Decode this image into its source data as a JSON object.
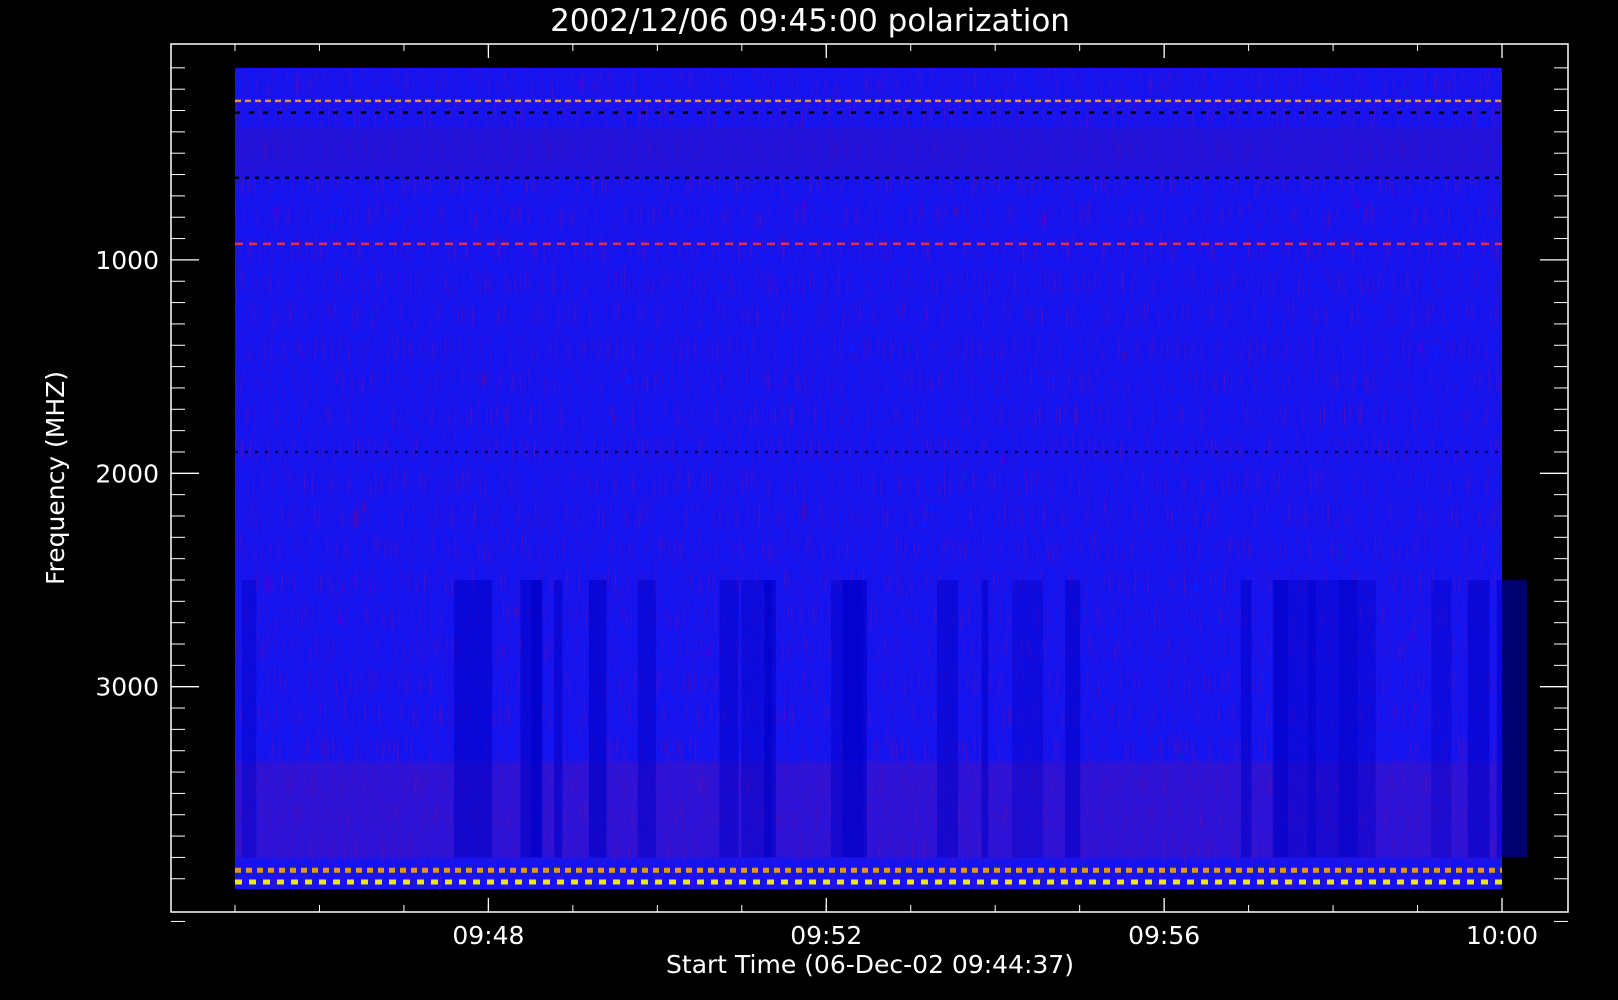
{
  "chart_data": {
    "type": "heatmap",
    "title": "2002/12/06 09:45:00 polarization",
    "xlabel": "Start Time (06-Dec-02 09:44:37)",
    "ylabel": "Frequency (MHZ)",
    "x_start": "09:45:00",
    "x_end": "10:00:00",
    "xlim": [
      "09:44:37",
      "10:00:00"
    ],
    "x_ticks": [
      "09:48",
      "09:52",
      "09:56",
      "10:00"
    ],
    "y_ticks": [
      1000,
      2000,
      3000
    ],
    "ylim": [
      4200,
      0
    ],
    "y_inverted": true,
    "y_range_data": [
      100,
      3950
    ],
    "colormap": [
      "#000000",
      "#1010ff",
      "#ff0000",
      "#ffa500",
      "#ffff00"
    ],
    "background_value_color": "#1414f0",
    "features": [
      {
        "frequency_mhz": 255,
        "color": "#ff9a30"
      },
      {
        "frequency_mhz": 310,
        "color": "#000000"
      },
      {
        "frequency_mhz": 615,
        "color": "#000000"
      },
      {
        "frequency_mhz": 925,
        "color": "#ff3030"
      },
      {
        "frequency_mhz": 1900,
        "color": "#000060"
      },
      {
        "frequency_mhz": 3860,
        "color": "#ffa500"
      },
      {
        "frequency_mhz": 3915,
        "color": "#ffff00"
      }
    ],
    "grid": false,
    "legend": "none"
  },
  "colors": {
    "background": "#000000",
    "axes": "#ffffff",
    "text": "#ffffff"
  }
}
